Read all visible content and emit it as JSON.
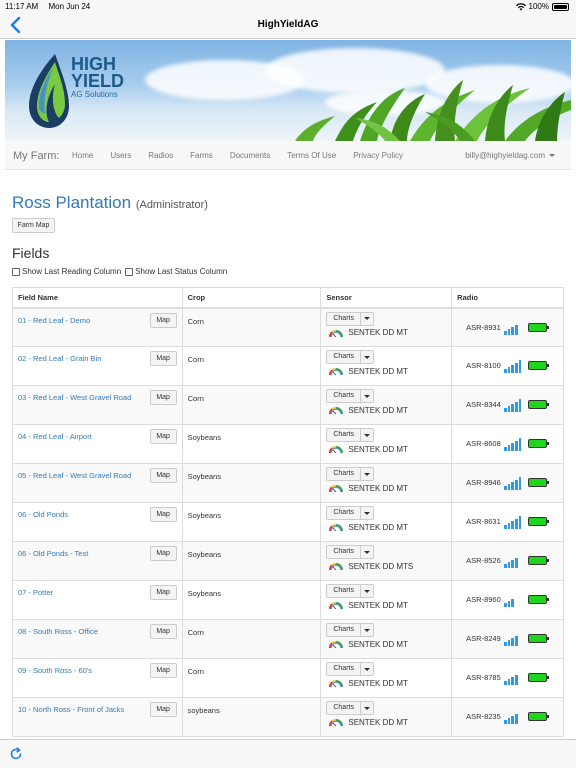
{
  "status": {
    "time": "11:17 AM",
    "date": "Mon Jun 24",
    "battery": "100%"
  },
  "nav": {
    "title": "HighYieldAG"
  },
  "logo": {
    "line1": "HIGH",
    "line2": "YIELD",
    "line3": "AG Solutions"
  },
  "topnav": {
    "brand": "My Farm:",
    "links": [
      "Home",
      "Users",
      "Radios",
      "Farms",
      "Documents",
      "Terms Of Use",
      "Privacy Policy"
    ],
    "user": "billy@highyieldag.com"
  },
  "farm": {
    "name": "Ross Plantation",
    "role": "(Administrator)",
    "map_button": "Farm Map"
  },
  "fields_heading": "Fields",
  "options": {
    "last_reading": "Show Last Reading Column",
    "last_status": "Show Last Status Column"
  },
  "table": {
    "headers": [
      "Field Name",
      "Crop",
      "Sensor",
      "Radio"
    ],
    "map_label": "Map",
    "charts_label": "Charts",
    "rows": [
      {
        "field": "01 - Red Leaf - Demo",
        "crop": "Corn",
        "sensor": "SENTEK DD MT",
        "radio": "ASR-8931",
        "signal": 4
      },
      {
        "field": "02 - Red Leaf - Grain Bin",
        "crop": "Corn",
        "sensor": "SENTEK DD MT",
        "radio": "ASR-8100",
        "signal": 5
      },
      {
        "field": "03 - Red Leaf - West Gravel Road",
        "crop": "Corn",
        "sensor": "SENTEK DD MT",
        "radio": "ASR-8344",
        "signal": 5
      },
      {
        "field": "04 - Red Leaf - Airport",
        "crop": "Soybeans",
        "sensor": "SENTEK DD MT",
        "radio": "ASR-8608",
        "signal": 5
      },
      {
        "field": "05 - Red Leaf - West Gravel Road",
        "crop": "Soybeans",
        "sensor": "SENTEK DD MT",
        "radio": "ASR-8946",
        "signal": 5
      },
      {
        "field": "06 - Old Ponds",
        "crop": "Soybeans",
        "sensor": "SENTEK DD MT",
        "radio": "ASR-8631",
        "signal": 5
      },
      {
        "field": "06 - Old Ponds - Test",
        "crop": "Soybeans",
        "sensor": "SENTEK DD MTS",
        "radio": "ASR-8526",
        "signal": 4
      },
      {
        "field": "07 - Potter",
        "crop": "Soybeans",
        "sensor": "SENTEK DD MT",
        "radio": "ASR-8960",
        "signal": 3
      },
      {
        "field": "08 - South Ross - Office",
        "crop": "Corn",
        "sensor": "SENTEK DD MT",
        "radio": "ASR-8249",
        "signal": 4
      },
      {
        "field": "09 - South Ross - 60's",
        "crop": "Corn",
        "sensor": "SENTEK DD MT",
        "radio": "ASR-8785",
        "signal": 4
      },
      {
        "field": "10 - North Ross - Front of Jacks",
        "crop": "soybeans",
        "sensor": "SENTEK DD MT",
        "radio": "ASR-8235",
        "signal": 4
      }
    ]
  },
  "colors": {
    "link": "#337ab7",
    "signal": "#2f9be5",
    "battery": "#1fd61f"
  },
  "icons": {
    "back": "chevron-left-icon",
    "refresh": "refresh-icon",
    "wifi": "wifi-icon"
  }
}
